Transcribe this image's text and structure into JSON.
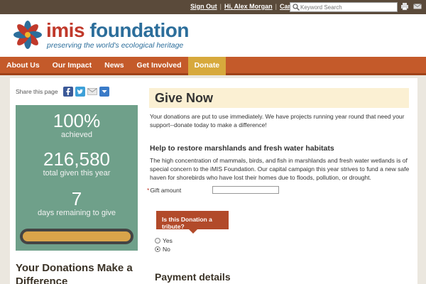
{
  "topbar": {
    "sign_out": "Sign Out",
    "user": "Hi, Alex Morgan",
    "cart": "Cart",
    "search_placeholder": "Keyword Search",
    "icons": [
      "cart-icon",
      "search-icon",
      "print-icon",
      "email-icon"
    ]
  },
  "brand": {
    "name_part1": "imis",
    "name_part2": "foundation",
    "tagline": "preserving the world's ecological heritage",
    "colors": {
      "red": "#c0392b",
      "blue": "#2c6e9b"
    }
  },
  "nav": {
    "items": [
      "About Us",
      "Our Impact",
      "News",
      "Get Involved",
      "Donate"
    ],
    "active": "Donate"
  },
  "share": {
    "label": "Share this page",
    "icons": [
      "facebook-icon",
      "twitter-icon",
      "email-icon",
      "more-icon"
    ]
  },
  "stats": {
    "percent": "100%",
    "percent_label": "achieved",
    "total": "216,580",
    "total_label": "total given this year",
    "days": "7",
    "days_label": "days remaining to give",
    "progress_fraction": 1.0
  },
  "left_heading": "Your Donations Make a Difference",
  "main": {
    "title": "Give Now",
    "intro": "Your donations are put to use immediately. We have projects running year round that need your support--donate today to make a difference!",
    "subheading": "Help to restore marshlands and fresh water habitats",
    "description": "The high concentration of mammals, birds, and fish in marshlands and fresh water wetlands is of special concern to the iMIS Foundation. Our capital campaign this year strives to fund a new safe haven for shorebirds who have lost their homes due to floods, pollution, or drought.",
    "gift_label": "Gift amount",
    "gift_value": "",
    "tribute_label": "Is this Donation a tribute?",
    "tribute_options": [
      "Yes",
      "No"
    ],
    "tribute_selected": "No",
    "payment_heading": "Payment details"
  }
}
